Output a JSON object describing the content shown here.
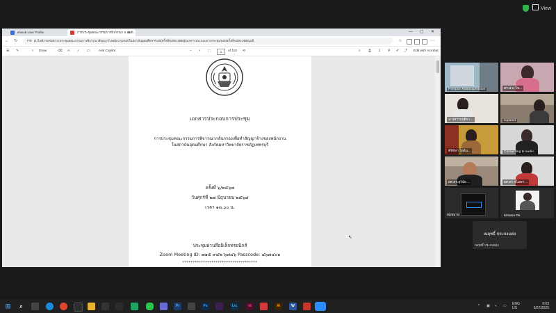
{
  "zoom": {
    "view_label": "View"
  },
  "browser": {
    "tabs": [
      {
        "label": "eNeub User Profile"
      },
      {
        "label": "การประชุมคณะกรรมการพิจารณา 6 256..."
      }
    ],
    "address_prefix": "File",
    "address": "D:/ไฟล์งาน%20การประชุมคณะกรรมการพิจารณาสัญญาจ้างพนักงาน%20ในสถาบันอุดมศึกษา%20(ครั้งที่%206-2568)/เอกสารประกอบการประชุม%20ครั้งที่%206-2568.pdf"
  },
  "pdf_toolbar": {
    "draw": "Draw",
    "ask_copilot": "Ask Copilot",
    "page_current": "1",
    "page_total": "of 110",
    "edit_acrobat": "Edit with Acrobat",
    "zoom_minus": "−",
    "zoom_plus": "+"
  },
  "document": {
    "title": "เอกสารประกอบการประชุม",
    "meeting_line1": "การประชุมคณะกรรมการพิจารณากลั่นกรองเพื่อทำสัญญาจ้างของพนักงาน",
    "meeting_line2": "ในสถาบันอุดมศึกษา สังกัดมหาวิทยาลัยราชภัฏเพชรบุรี",
    "session": "ครั้งที่ ๖/๒๕๖๘",
    "date": "วันศุกร์ที่ ๒๗ มิถุนายน ๒๕๖๘",
    "time": "เวลา ๑๓.๐๐ น.",
    "channel": "ประชุมผ่านสื่ออิเล็กทรอนิกส์",
    "zoom_meeting": "Zoom Meeting ID: ๗๑๕ ๙๔๒ ๖๗๔๖ Passcode: ๔๖๗๔๐๑",
    "divider": "************************************"
  },
  "participants": [
    {
      "name": "Pornpun Rattanaphiboon"
    },
    {
      "name": "ดร.นาง ไพ..."
    },
    {
      "name": "นางสาวกฤติกา ..."
    },
    {
      "name": "supanet"
    },
    {
      "name": "ดิจิทัลฯ ไพลิน..."
    },
    {
      "name": "Connecting to audio..."
    },
    {
      "name": "ผศ.ดร.สุวินัย ..."
    },
    {
      "name": "ผศ.ดร.ชไมพร ..."
    },
    {
      "name": "สมหมาย"
    },
    {
      "name": "Kitsana PK"
    }
  ],
  "name_card": {
    "big": "ณฤทธิ์ ประจงแต่ง",
    "small": "ณฤทธิ์ ประจงแต่ง"
  },
  "tray": {
    "lang1": "ENG",
    "lang2": "US",
    "time": "9:03",
    "date": "6/27/2025"
  }
}
